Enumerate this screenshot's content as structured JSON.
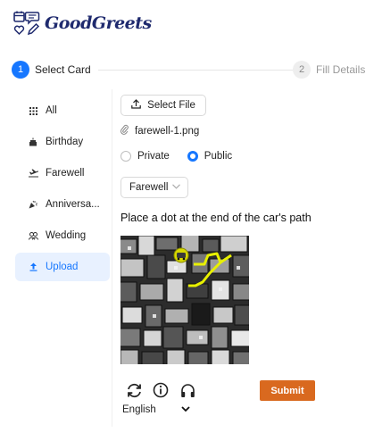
{
  "brand": {
    "name": "GoodGreets",
    "color": "#1f2a6e"
  },
  "steps": [
    {
      "number": "1",
      "label": "Select Card",
      "state": "active"
    },
    {
      "number": "2",
      "label": "Fill Details",
      "state": "inactive"
    }
  ],
  "nav": {
    "items": [
      {
        "label": "All",
        "icon": "grid-icon"
      },
      {
        "label": "Birthday",
        "icon": "cake-icon"
      },
      {
        "label": "Farewell",
        "icon": "plane-icon"
      },
      {
        "label": "Anniversa...",
        "icon": "party-popper-icon"
      },
      {
        "label": "Wedding",
        "icon": "people-icon"
      },
      {
        "label": "Upload",
        "icon": "upload-icon",
        "selected": true
      }
    ]
  },
  "upload": {
    "select_file_label": "Select File",
    "file_name": "farewell-1.png",
    "visibility": {
      "options": [
        "Private",
        "Public"
      ],
      "selected": "Public"
    },
    "category_value": "Farewell"
  },
  "captcha": {
    "prompt": "Place a dot at the end of the car's path",
    "language": "English",
    "submit_label": "Submit",
    "submit_color": "#d9691f"
  },
  "accent_color": "#1677ff"
}
